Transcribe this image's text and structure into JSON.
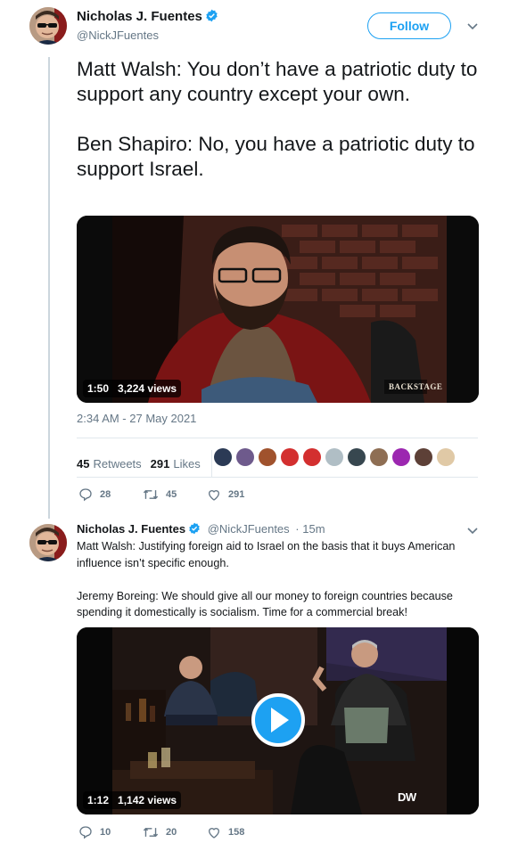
{
  "tweet1": {
    "author_name": "Nicholas J. Fuentes",
    "author_handle": "@NickJFuentes",
    "follow_label": "Follow",
    "text": "Matt Walsh: You don’t have a patriotic duty to support any country except your own.\n\nBen Shapiro: No, you have a patriotic duty to support Israel.",
    "video": {
      "duration": "1:50",
      "views": "3,224 views",
      "watermark": "BACKSTAGE"
    },
    "timestamp": "2:34 AM - 27 May 2021",
    "retweets_count": "45",
    "retweets_label": "Retweets",
    "likes_count": "291",
    "likes_label": "Likes",
    "liker_avatar_colors": [
      "#2b3a55",
      "#6e5a8c",
      "#a0522d",
      "#d32f2f",
      "#d32f2f",
      "#b0bec5",
      "#37474f",
      "#8e6e53",
      "#9c27b0",
      "#5d4037",
      "#e0c9a6"
    ],
    "actions": {
      "replies": "28",
      "retweets": "45",
      "likes": "291"
    }
  },
  "tweet2": {
    "author_name": "Nicholas J. Fuentes",
    "author_handle": "@NickJFuentes",
    "time_ago": "· 15m",
    "text": "Matt Walsh: Justifying foreign aid to Israel on the basis that it buys American influence isn’t specific enough.\n\nJeremy Boreing: We should give all our money to foreign countries because spending it domestically is socialism. Time for a commercial break!",
    "video": {
      "duration": "1:12",
      "views": "1,142 views",
      "watermark": "DW"
    },
    "actions": {
      "replies": "10",
      "retweets": "20",
      "likes": "158"
    }
  },
  "colors": {
    "accent": "#1da1f2",
    "muted": "#657786",
    "text": "#14171a",
    "border": "#e1e8ed"
  },
  "icons": [
    "verified-badge-icon",
    "chevron-down-icon",
    "reply-icon",
    "retweet-icon",
    "heart-icon",
    "play-icon"
  ]
}
